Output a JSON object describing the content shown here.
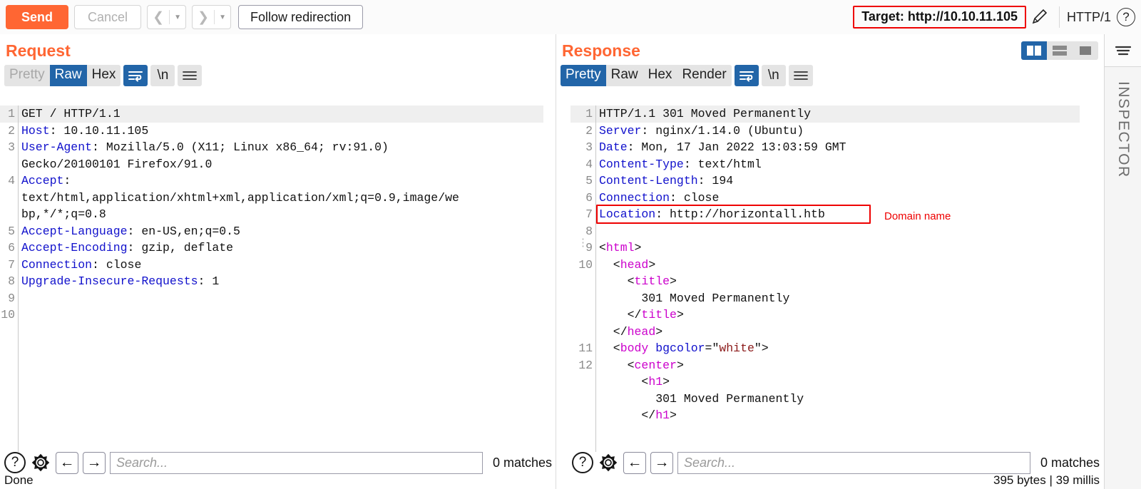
{
  "toolbar": {
    "send_label": "Send",
    "cancel_label": "Cancel",
    "prev_icon": "chevron-left-icon",
    "next_icon": "chevron-right-icon",
    "follow_redirection_label": "Follow redirection",
    "target_label": "Target: http://10.10.11.105",
    "edit_icon": "pencil-icon",
    "http_version": "HTTP/1",
    "help_icon": "question-circle-icon",
    "target_highlight_color": "#ee0000",
    "accent_color": "#ff6633"
  },
  "layout_buttons": [
    {
      "name": "split-vertical",
      "active": true
    },
    {
      "name": "split-horizontal",
      "active": false
    },
    {
      "name": "single-pane",
      "active": false
    }
  ],
  "inspector": {
    "label": "INSPECTOR",
    "menu_icon": "hamburger-icon"
  },
  "request": {
    "title": "Request",
    "tabs": [
      {
        "label": "Pretty",
        "active": false,
        "muted": true
      },
      {
        "label": "Raw",
        "active": true,
        "muted": false
      },
      {
        "label": "Hex",
        "active": false,
        "muted": false
      }
    ],
    "wrap_icon": "word-wrap-icon",
    "wrap_active": true,
    "newline_label": "\\n",
    "menu_icon": "hamburger-icon",
    "lines": [
      {
        "num": "1",
        "segments": [
          {
            "t": "GET / HTTP/1.1",
            "c": "punct"
          }
        ]
      },
      {
        "num": "2",
        "segments": [
          {
            "t": "Host",
            "c": "hdr"
          },
          {
            "t": ": 10.10.11.105",
            "c": "punct"
          }
        ]
      },
      {
        "num": "3",
        "segments": [
          {
            "t": "User-Agent",
            "c": "hdr"
          },
          {
            "t": ": Mozilla/5.0 (X11; Linux x86_64; rv:91.0)",
            "c": "punct"
          }
        ]
      },
      {
        "num": "",
        "segments": [
          {
            "t": "Gecko/20100101 Firefox/91.0",
            "c": "punct"
          }
        ]
      },
      {
        "num": "4",
        "segments": [
          {
            "t": "Accept",
            "c": "hdr"
          },
          {
            "t": ":",
            "c": "punct"
          }
        ]
      },
      {
        "num": "",
        "segments": [
          {
            "t": "text/html,application/xhtml+xml,application/xml;q=0.9,image/we",
            "c": "punct"
          }
        ]
      },
      {
        "num": "",
        "segments": [
          {
            "t": "bp,*/*;q=0.8",
            "c": "punct"
          }
        ]
      },
      {
        "num": "5",
        "segments": [
          {
            "t": "Accept-Language",
            "c": "hdr"
          },
          {
            "t": ": en-US,en;q=0.5",
            "c": "punct"
          }
        ]
      },
      {
        "num": "6",
        "segments": [
          {
            "t": "Accept-Encoding",
            "c": "hdr"
          },
          {
            "t": ": gzip, deflate",
            "c": "punct"
          }
        ]
      },
      {
        "num": "7",
        "segments": [
          {
            "t": "Connection",
            "c": "hdr"
          },
          {
            "t": ": close",
            "c": "punct"
          }
        ]
      },
      {
        "num": "8",
        "segments": [
          {
            "t": "Upgrade-Insecure-Requests",
            "c": "hdr"
          },
          {
            "t": ": 1",
            "c": "punct"
          }
        ]
      },
      {
        "num": "9",
        "segments": []
      },
      {
        "num": "10",
        "segments": []
      }
    ],
    "find": {
      "help_icon": "question-circle-icon",
      "settings_icon": "gear-icon",
      "prev_icon": "arrow-left-icon",
      "next_icon": "arrow-right-icon",
      "search_value": "",
      "search_placeholder": "Search...",
      "matches_label": "0 matches"
    },
    "status": "Done"
  },
  "response": {
    "title": "Response",
    "tabs": [
      {
        "label": "Pretty",
        "active": true,
        "muted": false
      },
      {
        "label": "Raw",
        "active": false,
        "muted": false
      },
      {
        "label": "Hex",
        "active": false,
        "muted": false
      },
      {
        "label": "Render",
        "active": false,
        "muted": false
      }
    ],
    "wrap_icon": "word-wrap-icon",
    "wrap_active": true,
    "newline_label": "\\n",
    "menu_icon": "hamburger-icon",
    "lines": [
      {
        "num": "1",
        "segments": [
          {
            "t": "HTTP/1.1 301 Moved Permanently",
            "c": "punct"
          }
        ]
      },
      {
        "num": "2",
        "segments": [
          {
            "t": "Server",
            "c": "hdr"
          },
          {
            "t": ": nginx/1.14.0 (Ubuntu)",
            "c": "punct"
          }
        ]
      },
      {
        "num": "3",
        "segments": [
          {
            "t": "Date",
            "c": "hdr"
          },
          {
            "t": ": Mon, 17 Jan 2022 13:03:59 GMT",
            "c": "punct"
          }
        ]
      },
      {
        "num": "4",
        "segments": [
          {
            "t": "Content-Type",
            "c": "hdr"
          },
          {
            "t": ": text/html",
            "c": "punct"
          }
        ]
      },
      {
        "num": "5",
        "segments": [
          {
            "t": "Content-Length",
            "c": "hdr"
          },
          {
            "t": ": 194",
            "c": "punct"
          }
        ]
      },
      {
        "num": "6",
        "segments": [
          {
            "t": "Connection",
            "c": "hdr"
          },
          {
            "t": ": close",
            "c": "punct"
          }
        ]
      },
      {
        "num": "7",
        "segments": [
          {
            "t": "Location",
            "c": "hdr"
          },
          {
            "t": ": http://horizontall.htb",
            "c": "punct"
          }
        ]
      },
      {
        "num": "8",
        "segments": []
      },
      {
        "num": "9",
        "segments": [
          {
            "t": "<",
            "c": "punct"
          },
          {
            "t": "html",
            "c": "tagname"
          },
          {
            "t": ">",
            "c": "punct"
          }
        ]
      },
      {
        "num": "10",
        "segments": [
          {
            "t": "  <",
            "c": "punct"
          },
          {
            "t": "head",
            "c": "tagname"
          },
          {
            "t": ">",
            "c": "punct"
          }
        ]
      },
      {
        "num": "",
        "segments": [
          {
            "t": "    <",
            "c": "punct"
          },
          {
            "t": "title",
            "c": "tagname"
          },
          {
            "t": ">",
            "c": "punct"
          }
        ]
      },
      {
        "num": "",
        "segments": [
          {
            "t": "      301 Moved Permanently",
            "c": "punct"
          }
        ]
      },
      {
        "num": "",
        "segments": [
          {
            "t": "    </",
            "c": "punct"
          },
          {
            "t": "title",
            "c": "tagname"
          },
          {
            "t": ">",
            "c": "punct"
          }
        ]
      },
      {
        "num": "",
        "segments": [
          {
            "t": "  </",
            "c": "punct"
          },
          {
            "t": "head",
            "c": "tagname"
          },
          {
            "t": ">",
            "c": "punct"
          }
        ]
      },
      {
        "num": "11",
        "segments": [
          {
            "t": "  <",
            "c": "punct"
          },
          {
            "t": "body",
            "c": "tagname"
          },
          {
            "t": " ",
            "c": "punct"
          },
          {
            "t": "bgcolor",
            "c": "attr"
          },
          {
            "t": "=\"",
            "c": "punct"
          },
          {
            "t": "white",
            "c": "attrval"
          },
          {
            "t": "\">",
            "c": "punct"
          }
        ]
      },
      {
        "num": "12",
        "segments": [
          {
            "t": "    <",
            "c": "punct"
          },
          {
            "t": "center",
            "c": "tagname"
          },
          {
            "t": ">",
            "c": "punct"
          }
        ]
      },
      {
        "num": "",
        "segments": [
          {
            "t": "      <",
            "c": "punct"
          },
          {
            "t": "h1",
            "c": "tagname"
          },
          {
            "t": ">",
            "c": "punct"
          }
        ]
      },
      {
        "num": "",
        "segments": [
          {
            "t": "        301 Moved Permanently",
            "c": "punct"
          }
        ]
      },
      {
        "num": "",
        "segments": [
          {
            "t": "      </",
            "c": "punct"
          },
          {
            "t": "h1",
            "c": "tagname"
          },
          {
            "t": ">",
            "c": "punct"
          }
        ]
      }
    ],
    "annotation": {
      "label": "Domain name",
      "color": "#ee0000"
    },
    "find": {
      "help_icon": "question-circle-icon",
      "settings_icon": "gear-icon",
      "prev_icon": "arrow-left-icon",
      "next_icon": "arrow-right-icon",
      "search_value": "",
      "search_placeholder": "Search...",
      "matches_label": "0 matches"
    },
    "status": "395 bytes | 39 millis"
  }
}
